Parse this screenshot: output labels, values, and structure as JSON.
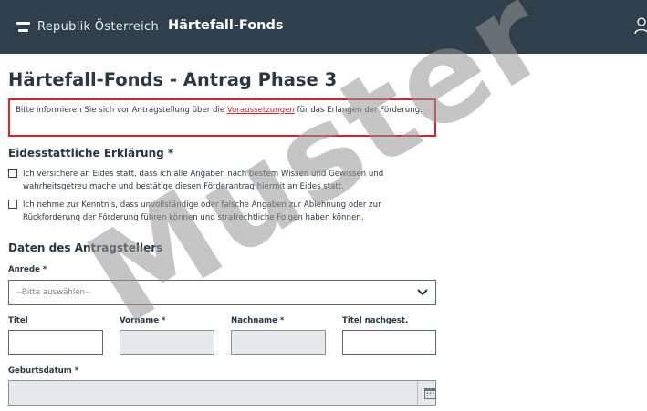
{
  "header": {
    "brand": "Republik Österreich",
    "app_name": "Härtefall-Fonds"
  },
  "page": {
    "title": "Härtefall-Fonds - Antrag Phase 3"
  },
  "notice": {
    "prefix": "Bitte informieren Sie sich vor Antragstellung über die ",
    "link": "Voraussetzungen",
    "suffix": " für das Erlangen der Förderung.",
    "color": "#d8232a"
  },
  "declaration": {
    "title": "Eidesstattliche Erklärung *",
    "items": [
      {
        "checked": false,
        "text": "Ich versichere an Eides statt, dass ich alle Angaben nach bestem Wissen und Gewissen und wahrheitsgetreu mache und bestätige diesen Förderantrag hiermit an Eides statt."
      },
      {
        "checked": false,
        "text": "Ich nehme zur Kenntnis, dass unvollständige oder falsche Angaben zur Ablehnung oder zur Rückforderung der Förderung führen können und strafrechtliche Folgen haben können."
      }
    ]
  },
  "applicant": {
    "title": "Daten des Antragstellers",
    "salutation": {
      "label": "Anrede *",
      "placeholder": "--Bitte auswählen--"
    },
    "titel": {
      "label": "Titel",
      "value": ""
    },
    "vorname": {
      "label": "Vorname *",
      "value": ""
    },
    "nachname": {
      "label": "Nachname *",
      "value": ""
    },
    "titel_nach": {
      "label": "Titel nachgest.",
      "value": ""
    },
    "birthdate": {
      "label": "Geburtsdatum *",
      "value": ""
    }
  },
  "watermark": {
    "text": "Muster"
  },
  "colors": {
    "header_bg": "#2f3f4c",
    "accent_red": "#d8232a",
    "disabled_bg": "#e6e9eb"
  },
  "icons": {
    "brand": "flag-icon",
    "user": "user-icon",
    "select": "chevron-down-icon",
    "calendar": "calendar-icon"
  }
}
